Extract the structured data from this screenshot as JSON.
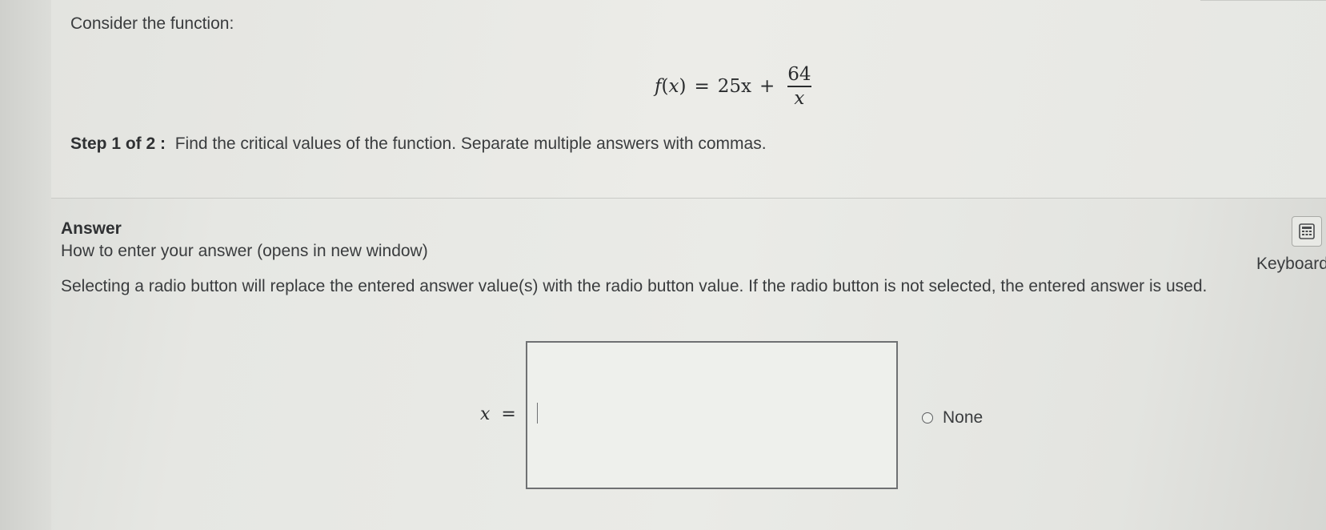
{
  "question": {
    "intro": "Consider the function:",
    "formula": {
      "lhs_fn": "f",
      "lhs_arg": "x",
      "equals": "=",
      "term1": "25x",
      "plus": "+",
      "numerator": "64",
      "denominator": "x"
    },
    "step_label": "Step 1 of 2 :",
    "step_text": "Find the critical values of the function. Separate multiple answers with commas."
  },
  "answer": {
    "title": "Answer",
    "help_link": "How to enter your answer (opens in new window)",
    "keyboard_label": "Keyboard",
    "keyboard_icon": "calculator-icon",
    "instructions": "Selecting a radio button will replace the entered answer value(s) with the radio button value. If the radio button is not selected, the entered answer is used.",
    "input_var": "x",
    "input_equals": "=",
    "input_value": "",
    "radio_label": "None",
    "radio_selected": false
  }
}
